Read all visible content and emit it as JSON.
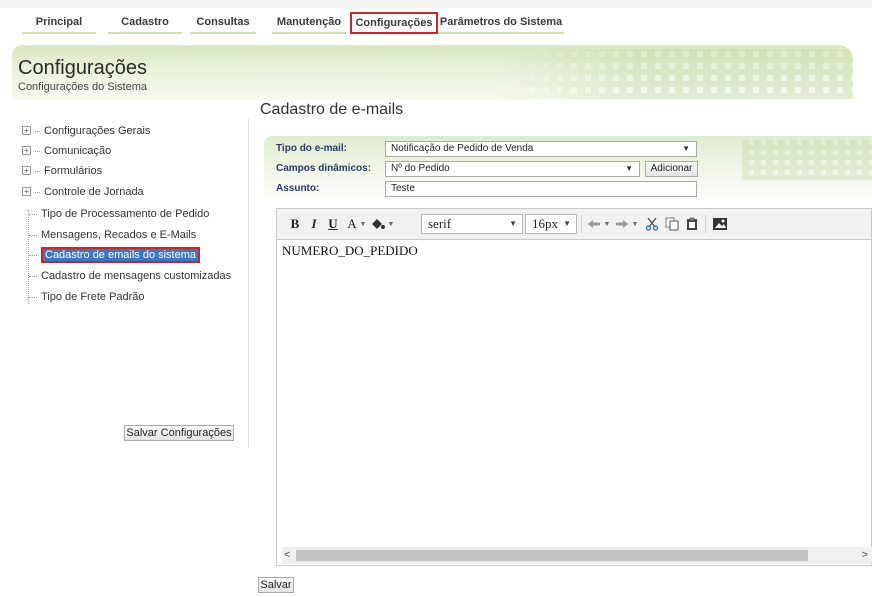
{
  "topnav": {
    "tabs": [
      {
        "label": "Principal"
      },
      {
        "label": "Cadastro"
      },
      {
        "label": "Consultas"
      },
      {
        "label": "Manutenção"
      },
      {
        "label": "Configurações",
        "active": true
      },
      {
        "label": "Parâmetros do Sistema"
      }
    ]
  },
  "header": {
    "title": "Configurações",
    "subtitle": "Configurações do Sistema"
  },
  "page": {
    "section_title": "Cadastro de e-mails"
  },
  "sidebar": {
    "items": [
      {
        "label": "Configurações Gerais",
        "expandable": true
      },
      {
        "label": "Comunicação",
        "expandable": true
      },
      {
        "label": "Formulários",
        "expandable": true
      },
      {
        "label": "Controle de Jornada",
        "expandable": true
      },
      {
        "label": "Tipo de Processamento de Pedido"
      },
      {
        "label": "Mensagens, Recados e E-Mails"
      },
      {
        "label": "Cadastro de emails do sistema",
        "selected": true
      },
      {
        "label": "Cadastro de mensagens customizadas"
      },
      {
        "label": "Tipo de Frete Padrão"
      }
    ],
    "save_button": "Salvar Configurações"
  },
  "form": {
    "email_type_label": "Tipo do e-mail:",
    "email_type_value": "Notificação de Pedido de Venda",
    "dynamic_fields_label": "Campos dinâmicos:",
    "dynamic_fields_value": "Nº do Pedido",
    "add_button": "Adicionar",
    "subject_label": "Assunto:",
    "subject_value": "Teste"
  },
  "editor": {
    "toolbar": {
      "bold": "B",
      "italic": "I",
      "underline": "U",
      "font_color": "A",
      "font_family": "serif",
      "font_size": "16px"
    },
    "content": "NUMERO_DO_PEDIDO"
  },
  "actions": {
    "save_button": "Salvar"
  },
  "colors": {
    "accent_green": "#cfe2ad",
    "highlight_red": "#c62828",
    "selected_blue": "#3b78c4"
  }
}
